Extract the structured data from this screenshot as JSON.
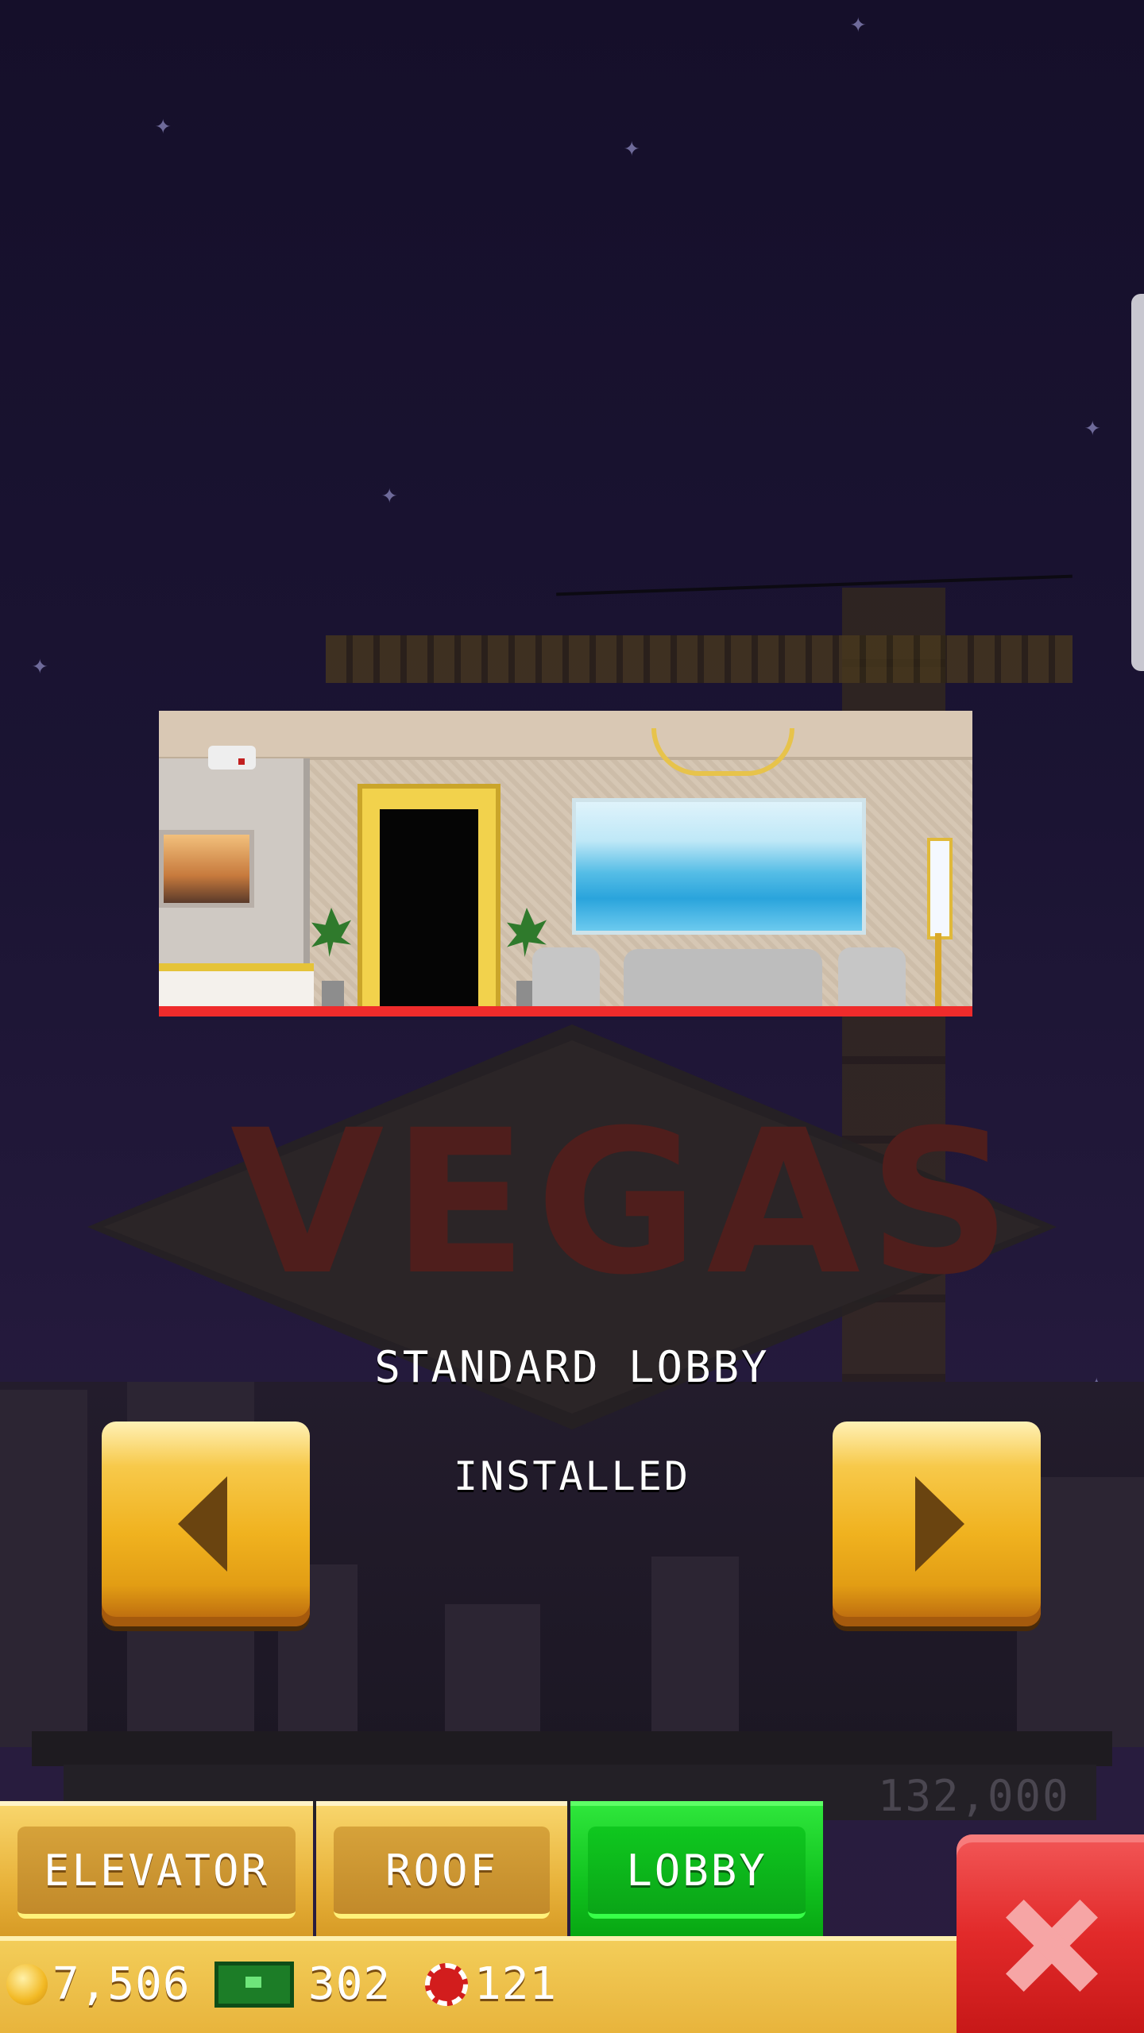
{
  "room": {
    "name": "STANDARD LOBBY",
    "status": "INSTALLED"
  },
  "background": {
    "sign_text": "VEGAS",
    "price": "132,000"
  },
  "tabs": [
    {
      "label": "ELEVATOR",
      "active": false
    },
    {
      "label": "ROOF",
      "active": false
    },
    {
      "label": "LOBBY",
      "active": true
    }
  ],
  "currency": {
    "coins": "7,506",
    "bux": "302",
    "chips": "121"
  },
  "icons": {
    "prev": "triangle-left-icon",
    "next": "triangle-right-icon",
    "close": "x-icon",
    "coin": "gold-coin-icon",
    "bux": "tower-bux-icon",
    "chip": "casino-chip-icon"
  },
  "colors": {
    "active_tab": "#10c11e",
    "gold": "#f0b21f",
    "close": "#e22a2a"
  }
}
